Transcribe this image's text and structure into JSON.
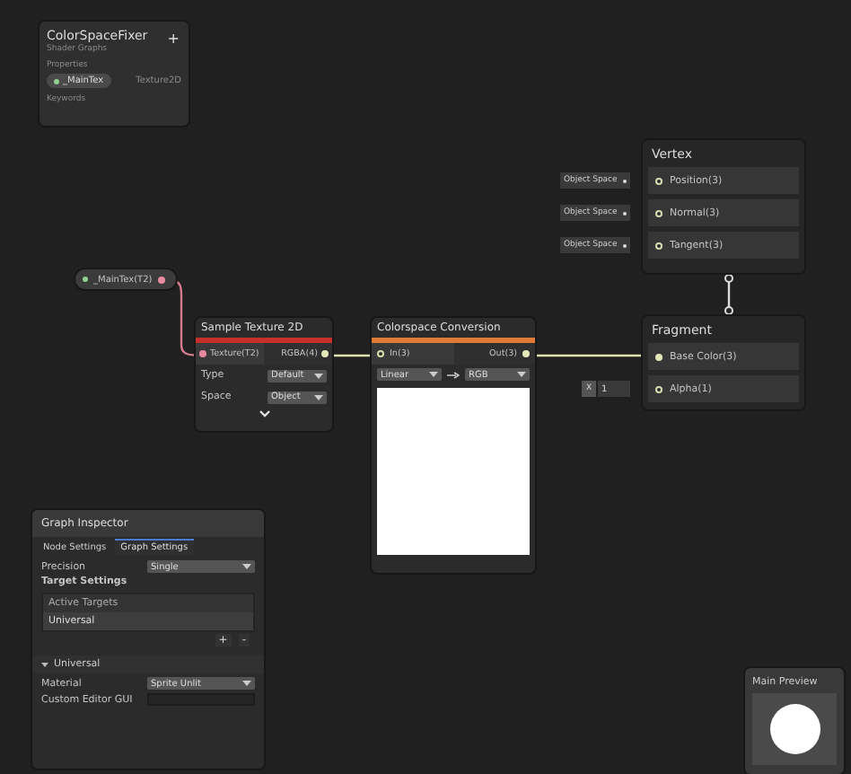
{
  "blackboard": {
    "title": "ColorSpaceFixer",
    "subtitle": "Shader Graphs",
    "add_label": "+",
    "properties_heading": "Properties",
    "properties": [
      {
        "name": "_MainTex",
        "type": "Texture2D"
      }
    ],
    "keywords_heading": "Keywords"
  },
  "property_node": {
    "label": "_MainTex(T2)"
  },
  "sample_texture": {
    "title": "Sample Texture 2D",
    "input": "Texture(T2)",
    "output": "RGBA(4)",
    "settings": [
      {
        "label": "Type",
        "value": "Default"
      },
      {
        "label": "Space",
        "value": "Object"
      }
    ]
  },
  "colorspace": {
    "title": "Colorspace Conversion",
    "input": "In(3)",
    "output": "Out(3)",
    "from": "Linear",
    "to": "RGB"
  },
  "vertex": {
    "title": "Vertex",
    "ports": [
      {
        "space": "Object Space",
        "label": "Position(3)"
      },
      {
        "space": "Object Space",
        "label": "Normal(3)"
      },
      {
        "space": "Object Space",
        "label": "Tangent(3)"
      }
    ]
  },
  "fragment": {
    "title": "Fragment",
    "ports": [
      {
        "label": "Base Color(3)",
        "kind": "color"
      },
      {
        "label": "Alpha(1)",
        "kind": "float",
        "axis": "X",
        "value": "1"
      }
    ]
  },
  "graph_inspector": {
    "title": "Graph Inspector",
    "tabs": [
      {
        "label": "Node Settings",
        "selected": false
      },
      {
        "label": "Graph Settings",
        "selected": true
      }
    ],
    "precision": {
      "label": "Precision",
      "value": "Single"
    },
    "target_heading": "Target Settings",
    "targets": {
      "header": "Active Targets",
      "items": [
        {
          "label": "Universal",
          "selected": true
        }
      ],
      "add": "+",
      "remove": "-"
    },
    "section": {
      "title": "Universal",
      "expanded": true,
      "fields": [
        {
          "label": "Material",
          "kind": "dropdown",
          "value": "Sprite Unlit"
        },
        {
          "label": "Custom Editor GUI",
          "kind": "text"
        }
      ]
    }
  },
  "main_preview": {
    "title": "Main Preview"
  }
}
